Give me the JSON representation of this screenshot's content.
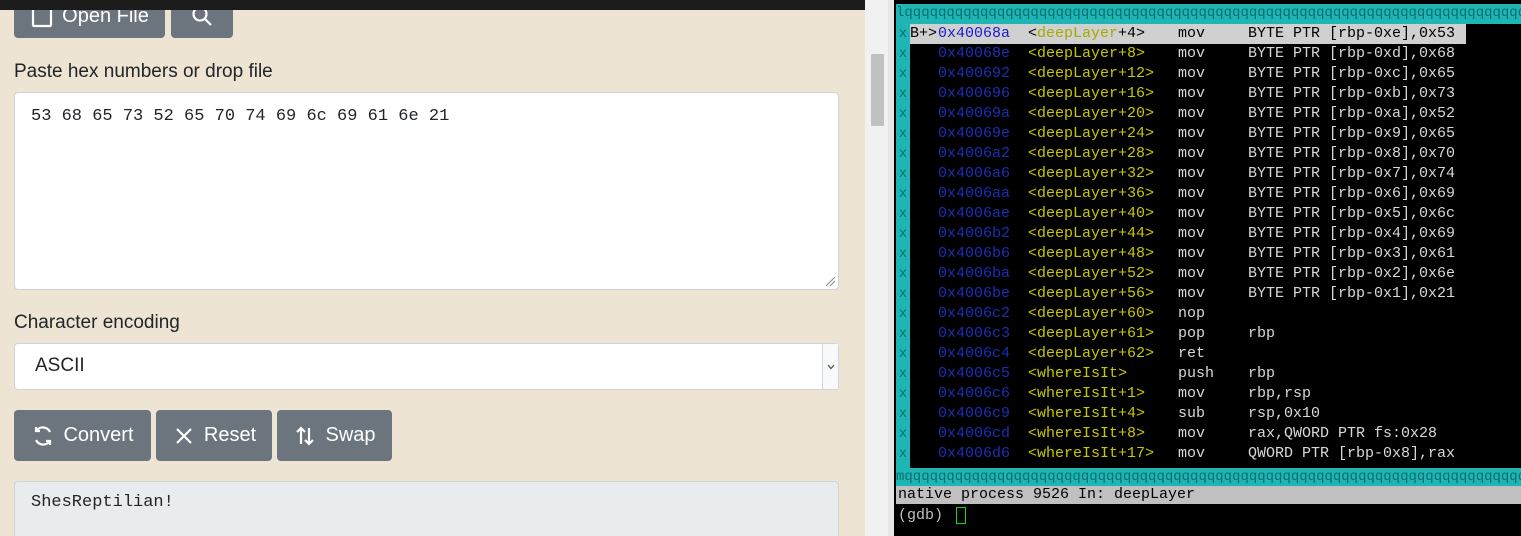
{
  "toolbar": {
    "open_file_label": "Open File"
  },
  "input": {
    "label": "Paste hex numbers or drop file",
    "value": "53 68 65 73 52 65 70 74 69 6c 69 61 6e 21"
  },
  "encoding": {
    "label": "Character encoding",
    "selected": "ASCII"
  },
  "actions": {
    "convert_label": "Convert",
    "reset_label": "Reset",
    "swap_label": "Swap"
  },
  "output": {
    "value": "ShesReptilian!"
  },
  "terminal": {
    "border_top": "lqqqqqqqqqqqqqqqqqqqqqqqqqqqqqqqqqqqqqqqqqqqqqqqqqqqqqqqqqqqqqqqqqqqqqqqqqqqqqqqqqqqqqqqqqq",
    "border_bottom": "mqqqqqqqqqqqqqqqqqqqqqqqqqqqqqqqqqqqqqqqqqqqqqqqqqqqqqqqqqqqqqqqqqqqqqqqqqqqqqqqqqqqqqqqqqq",
    "side_char": "x",
    "rows": [
      {
        "bp": "B+>",
        "addr": "0x40068a",
        "func_name": "deepLayer",
        "func_off": "+4>",
        "op": "mov",
        "args": "BYTE PTR [rbp-0xe],0x53",
        "current": true
      },
      {
        "bp": "",
        "addr": "0x40068e",
        "func": "<deepLayer+8>",
        "op": "mov",
        "args": "BYTE PTR [rbp-0xd],0x68"
      },
      {
        "bp": "",
        "addr": "0x400692",
        "func": "<deepLayer+12>",
        "op": "mov",
        "args": "BYTE PTR [rbp-0xc],0x65"
      },
      {
        "bp": "",
        "addr": "0x400696",
        "func": "<deepLayer+16>",
        "op": "mov",
        "args": "BYTE PTR [rbp-0xb],0x73"
      },
      {
        "bp": "",
        "addr": "0x40069a",
        "func": "<deepLayer+20>",
        "op": "mov",
        "args": "BYTE PTR [rbp-0xa],0x52"
      },
      {
        "bp": "",
        "addr": "0x40069e",
        "func": "<deepLayer+24>",
        "op": "mov",
        "args": "BYTE PTR [rbp-0x9],0x65"
      },
      {
        "bp": "",
        "addr": "0x4006a2",
        "func": "<deepLayer+28>",
        "op": "mov",
        "args": "BYTE PTR [rbp-0x8],0x70"
      },
      {
        "bp": "",
        "addr": "0x4006a6",
        "func": "<deepLayer+32>",
        "op": "mov",
        "args": "BYTE PTR [rbp-0x7],0x74"
      },
      {
        "bp": "",
        "addr": "0x4006aa",
        "func": "<deepLayer+36>",
        "op": "mov",
        "args": "BYTE PTR [rbp-0x6],0x69"
      },
      {
        "bp": "",
        "addr": "0x4006ae",
        "func": "<deepLayer+40>",
        "op": "mov",
        "args": "BYTE PTR [rbp-0x5],0x6c"
      },
      {
        "bp": "",
        "addr": "0x4006b2",
        "func": "<deepLayer+44>",
        "op": "mov",
        "args": "BYTE PTR [rbp-0x4],0x69"
      },
      {
        "bp": "",
        "addr": "0x4006b6",
        "func": "<deepLayer+48>",
        "op": "mov",
        "args": "BYTE PTR [rbp-0x3],0x61"
      },
      {
        "bp": "",
        "addr": "0x4006ba",
        "func": "<deepLayer+52>",
        "op": "mov",
        "args": "BYTE PTR [rbp-0x2],0x6e"
      },
      {
        "bp": "",
        "addr": "0x4006be",
        "func": "<deepLayer+56>",
        "op": "mov",
        "args": "BYTE PTR [rbp-0x1],0x21"
      },
      {
        "bp": "",
        "addr": "0x4006c2",
        "func": "<deepLayer+60>",
        "op": "nop",
        "args": ""
      },
      {
        "bp": "",
        "addr": "0x4006c3",
        "func": "<deepLayer+61>",
        "op": "pop",
        "args": "rbp"
      },
      {
        "bp": "",
        "addr": "0x4006c4",
        "func": "<deepLayer+62>",
        "op": "ret",
        "args": ""
      },
      {
        "bp": "",
        "addr": "0x4006c5",
        "func": "<whereIsIt>",
        "op": "push",
        "args": "rbp"
      },
      {
        "bp": "",
        "addr": "0x4006c6",
        "func": "<whereIsIt+1>",
        "op": "mov",
        "args": "rbp,rsp"
      },
      {
        "bp": "",
        "addr": "0x4006c9",
        "func": "<whereIsIt+4>",
        "op": "sub",
        "args": "rsp,0x10"
      },
      {
        "bp": "",
        "addr": "0x4006cd",
        "func": "<whereIsIt+8>",
        "op": "mov",
        "args": "rax,QWORD PTR fs:0x28"
      },
      {
        "bp": "",
        "addr": "0x4006d6",
        "func": "<whereIsIt+17>",
        "op": "mov",
        "args": "QWORD PTR [rbp-0x8],rax"
      }
    ],
    "status": "native process 9526 In: deepLayer",
    "prompt": "(gdb) "
  }
}
